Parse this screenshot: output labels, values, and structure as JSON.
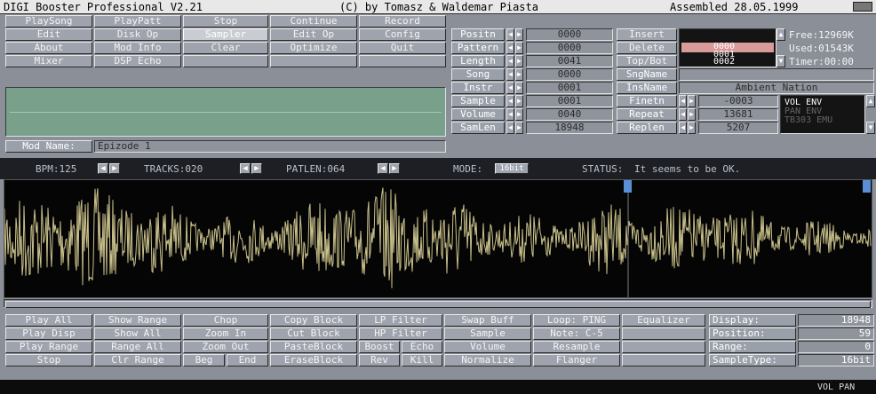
{
  "window": {
    "title": "DIGI Booster Professional V2.21",
    "copyright": "(C) by Tomasz & Waldemar Piasta",
    "assembled": "Assembled 28.05.1999"
  },
  "main_buttons": {
    "play_song": "PlaySong",
    "play_patt": "PlayPatt",
    "stop": "Stop",
    "continue": "Continue",
    "record": "Record",
    "edit": "Edit",
    "disk_op": "Disk Op",
    "sampler": "Sampler",
    "edit_op": "Edit Op",
    "config": "Config",
    "about": "About",
    "mod_info": "Mod Info",
    "clear": "Clear",
    "optimize": "Optimize",
    "quit": "Quit",
    "mixer": "Mixer",
    "dsp_echo": "DSP Echo"
  },
  "song_fields": {
    "position_label": "Positn",
    "position_value": "0000",
    "pattern_label": "Pattern",
    "pattern_value": "0000",
    "length_label": "Length",
    "length_value": "0041",
    "song_label": "Song",
    "song_value": "0000",
    "instr_label": "Instr",
    "instr_value": "0001",
    "sample_label": "Sample",
    "sample_value": "0001",
    "volume_label": "Volume",
    "volume_value": "0040",
    "samlen_label": "SamLen",
    "samlen_value": "18948"
  },
  "edit_buttons": {
    "insert": "Insert",
    "delete": "Delete",
    "top_bot": "Top/Bot"
  },
  "list": {
    "values": [
      "0000",
      "0001",
      "0002"
    ]
  },
  "instrument": {
    "sng_name_label": "SngName",
    "sng_name_value": "",
    "ins_name_label": "InsName",
    "ins_name_value": "Ambient Nation",
    "finetn_label": "Finetn",
    "finetn_value": "-0003",
    "repeat_label": "Repeat",
    "repeat_value": "13681",
    "replen_label": "Replen",
    "replen_value": "5207"
  },
  "envelopes": [
    "VOL ENV",
    "PAN ENV",
    "TB303 EMU"
  ],
  "memory": {
    "free": "Free:12969K",
    "used": "Used:01543K",
    "timer": "Timer:00:00"
  },
  "mod_name": {
    "label": "Mod Name:",
    "value": "Epizode 1"
  },
  "status_bar": {
    "bpm": "BPM:125",
    "tracks": "TRACKS:020",
    "patlen": "PATLEN:064",
    "mode_label": "MODE:",
    "mode_value": "16bit",
    "status_label": "STATUS:",
    "status_text": "It seems to be OK."
  },
  "sampler_buttons": {
    "play_all": "Play All",
    "show_range": "Show Range",
    "chop": "Chop",
    "copy_block": "Copy Block",
    "lp_filter": "LP Filter",
    "swap_buff": "Swap Buff",
    "loop": "Loop: PING",
    "equalizer": "Equalizer",
    "play_disp": "Play Disp",
    "show_all": "Show All",
    "zoom_in": "Zoom In",
    "cut_block": "Cut Block",
    "hp_filter": "HP Filter",
    "sample": "Sample",
    "note": "Note: C-5",
    "play_range": "Play Range",
    "range_all": "Range All",
    "zoom_out": "Zoom Out",
    "paste_block": "PasteBlock",
    "boost": "Boost",
    "echo": "Echo",
    "volume": "Volume",
    "resample": "Resample",
    "stop": "Stop",
    "clr_range": "Clr Range",
    "beg": "Beg",
    "end": "End",
    "erase_block": "EraseBlock",
    "rev": "Rev",
    "kill": "Kill",
    "normalize": "Normalize",
    "flanger": "Flanger"
  },
  "display_info": {
    "display_label": "Display:",
    "display_value": "18948",
    "position_label": "Position:",
    "position_value": "59",
    "range_label": "Range:",
    "range_value": "0",
    "sample_type_label": "SampleType:",
    "sample_type_value": "16bit"
  },
  "footer": {
    "right": "VOL  PAN"
  },
  "colors": {
    "background": "#8a8f98",
    "waveform": "#c9c08a",
    "status_bar": "#1d1f24",
    "marker": "#5a8fd6"
  }
}
